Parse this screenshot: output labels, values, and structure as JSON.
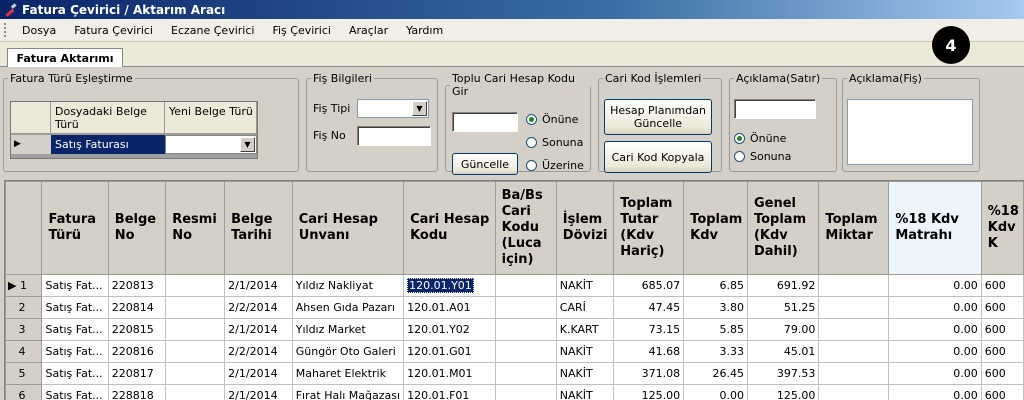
{
  "window": {
    "title": "Fatura Çevirici / Aktarım Aracı"
  },
  "menu": [
    "Dosya",
    "Fatura Çevirici",
    "Eczane Çevirici",
    "Fiş Çevirici",
    "Araçlar",
    "Yardım"
  ],
  "tab": {
    "label": "Fatura Aktarımı"
  },
  "badge": "4",
  "fatura_turu": {
    "legend": "Fatura Türü Eşleştirme",
    "col1": "Dosyadaki Belge Türü",
    "col2": "Yeni Belge Türü",
    "row_value": "Satış Faturası",
    "row_indicator": "▶"
  },
  "fis_bilgileri": {
    "legend": "Fiş Bilgileri",
    "fis_tipi_label": "Fiş Tipi",
    "fis_no_label": "Fiş No"
  },
  "toplu": {
    "legend": "Toplu Cari Hesap Kodu Gir",
    "radio_onune": "Önüne",
    "radio_sonuna": "Sonuna",
    "radio_uzerine": "Üzerine",
    "guncelle": "Güncelle"
  },
  "cari_kod": {
    "legend": "Cari Kod İşlemleri",
    "btn_hesap": "Hesap Planımdan Güncelle",
    "btn_kopyala": "Cari Kod Kopyala"
  },
  "aciklama_satir": {
    "legend": "Açıklama(Satır)",
    "radio_onune": "Önüne",
    "radio_sonuna": "Sonuna"
  },
  "aciklama_fis": {
    "legend": "Açıklama(Fiş)"
  },
  "grid": {
    "columns": [
      "Fatura Türü",
      "Belge No",
      "Resmi No",
      "Belge Tarihi",
      "Cari Hesap Unvanı",
      "Cari Hesap Kodu",
      "Ba/Bs Cari Kodu (Luca için)",
      "İşlem Dövizi",
      "Toplam Tutar (Kdv Hariç)",
      "Toplam Kdv",
      "Genel Toplam (Kdv Dahil)",
      "Toplam Miktar",
      "%18 Kdv Matrahı",
      "%18 Kdv K"
    ],
    "rows": [
      {
        "n": "1",
        "tur": "Satış Fat...",
        "belge": "220813",
        "resmi": "",
        "tarih": "2/1/2014",
        "unvan": "Yıldız Nakliyat",
        "kod": "120.01.Y01",
        "babs": "",
        "doviz": "NAKİT",
        "tutar": "685.07",
        "kdv": "6.85",
        "genel": "691.92",
        "miktar": "",
        "matrah": "0.00",
        "k18": "600"
      },
      {
        "n": "2",
        "tur": "Satış Fat...",
        "belge": "220814",
        "resmi": "",
        "tarih": "2/2/2014",
        "unvan": "Ahsen Gıda Pazarı",
        "kod": "120.01.A01",
        "babs": "",
        "doviz": "CARİ",
        "tutar": "47.45",
        "kdv": "3.80",
        "genel": "51.25",
        "miktar": "",
        "matrah": "0.00",
        "k18": "600"
      },
      {
        "n": "3",
        "tur": "Satış Fat...",
        "belge": "220815",
        "resmi": "",
        "tarih": "2/1/2014",
        "unvan": "Yıldız Market",
        "kod": "120.01.Y02",
        "babs": "",
        "doviz": "K.KART",
        "tutar": "73.15",
        "kdv": "5.85",
        "genel": "79.00",
        "miktar": "",
        "matrah": "0.00",
        "k18": "600"
      },
      {
        "n": "4",
        "tur": "Satış Fat...",
        "belge": "220816",
        "resmi": "",
        "tarih": "2/2/2014",
        "unvan": "Güngör Oto Galeri",
        "kod": "120.01.G01",
        "babs": "",
        "doviz": "NAKİT",
        "tutar": "41.68",
        "kdv": "3.33",
        "genel": "45.01",
        "miktar": "",
        "matrah": "0.00",
        "k18": "600"
      },
      {
        "n": "5",
        "tur": "Satış Fat...",
        "belge": "220817",
        "resmi": "",
        "tarih": "2/1/2014",
        "unvan": "Maharet Elektrik",
        "kod": "120.01.M01",
        "babs": "",
        "doviz": "NAKİT",
        "tutar": "371.08",
        "kdv": "26.45",
        "genel": "397.53",
        "miktar": "",
        "matrah": "0.00",
        "k18": "600"
      },
      {
        "n": "6",
        "tur": "Satış Fat...",
        "belge": "228818",
        "resmi": "",
        "tarih": "2/1/2014",
        "unvan": "Fırat Halı Mağazası",
        "kod": "120.01.F01",
        "babs": "",
        "doviz": "NAKİT",
        "tutar": "125.00",
        "kdv": "0.00",
        "genel": "125.00",
        "miktar": "",
        "matrah": "0.00",
        "k18": "600"
      }
    ]
  }
}
